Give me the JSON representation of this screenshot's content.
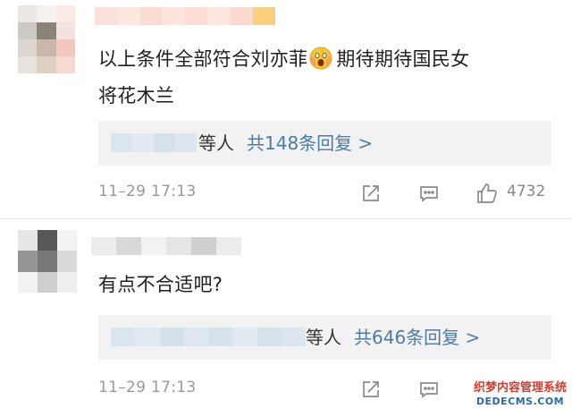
{
  "comments": [
    {
      "text_lines": [
        "以上条件全部符合刘亦菲",
        "期待期待国民女",
        "将花木兰"
      ],
      "emoji": "screaming-face-emoji",
      "reply": {
        "who_suffix": "等人",
        "count_label": "共148条回复 >"
      },
      "time": "11–29 17:13",
      "likes": "4732"
    },
    {
      "text": "有点不合适吧?",
      "reply": {
        "who_suffix": "等人",
        "count_label": "共646条回复 >"
      },
      "time": "11–29 17:13"
    }
  ],
  "icons": {
    "share": "share-icon",
    "comment": "comment-icon",
    "like": "thumbs-up-icon"
  },
  "watermark": {
    "title": "织梦内容管理系统",
    "domain": "DEDECMS.COM"
  },
  "colors": {
    "link": "#4d7ba8",
    "meta": "#999999",
    "reply_bg": "#f2f2f2",
    "watermark_red": "#d93a2b",
    "watermark_blue": "#2b6aa6"
  }
}
